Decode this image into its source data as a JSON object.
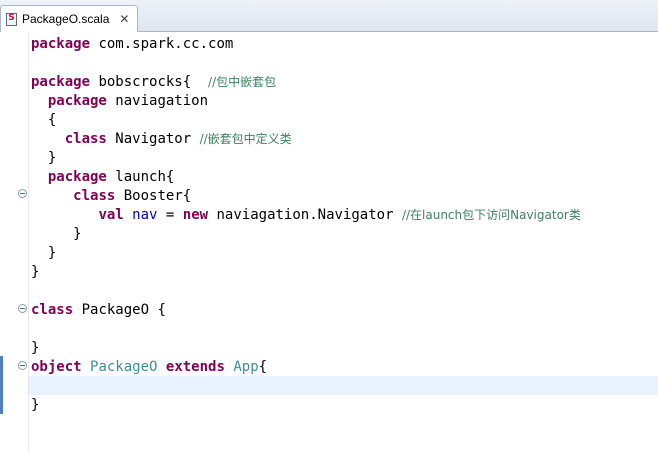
{
  "tab": {
    "title": "PackageO.scala",
    "icon": "scala-file-icon",
    "close": "✕"
  },
  "code": {
    "lines": [
      [
        {
          "t": "package",
          "c": "kw"
        },
        {
          "t": " com.spark.cc.com",
          "c": "tx"
        }
      ],
      [],
      [
        {
          "t": "package",
          "c": "kw"
        },
        {
          "t": " bobscrocks{  ",
          "c": "tx"
        },
        {
          "t": "//包中嵌套包",
          "c": "cm"
        }
      ],
      [
        {
          "t": "  ",
          "c": "tx"
        },
        {
          "t": "package",
          "c": "kw"
        },
        {
          "t": " naviagation",
          "c": "tx"
        }
      ],
      [
        {
          "t": "  {",
          "c": "tx"
        }
      ],
      [
        {
          "t": "    ",
          "c": "tx"
        },
        {
          "t": "class",
          "c": "kw"
        },
        {
          "t": " Navigator ",
          "c": "tx"
        },
        {
          "t": "//嵌套包中定义类",
          "c": "cm"
        }
      ],
      [
        {
          "t": "  }",
          "c": "tx"
        }
      ],
      [
        {
          "t": "  ",
          "c": "tx"
        },
        {
          "t": "package",
          "c": "kw"
        },
        {
          "t": " launch{",
          "c": "tx"
        }
      ],
      [
        {
          "t": "     ",
          "c": "tx"
        },
        {
          "t": "class",
          "c": "kw"
        },
        {
          "t": " Booster{",
          "c": "tx"
        }
      ],
      [
        {
          "t": "        ",
          "c": "tx"
        },
        {
          "t": "val",
          "c": "kw"
        },
        {
          "t": " ",
          "c": "tx"
        },
        {
          "t": "nav",
          "c": "nav"
        },
        {
          "t": " = ",
          "c": "tx"
        },
        {
          "t": "new",
          "c": "kw"
        },
        {
          "t": " naviagation.Navigator ",
          "c": "tx"
        },
        {
          "t": "//在launch包下访问Navigator类",
          "c": "cm"
        }
      ],
      [
        {
          "t": "     }",
          "c": "tx"
        }
      ],
      [
        {
          "t": "  }",
          "c": "tx"
        }
      ],
      [
        {
          "t": "}",
          "c": "tx"
        }
      ],
      [],
      [
        {
          "t": "class",
          "c": "kw"
        },
        {
          "t": " PackageO {",
          "c": "tx"
        }
      ],
      [],
      [
        {
          "t": "}",
          "c": "tx"
        }
      ],
      [
        {
          "t": "object",
          "c": "kw"
        },
        {
          "t": " ",
          "c": "tx"
        },
        {
          "t": "PackageO",
          "c": "ty"
        },
        {
          "t": " ",
          "c": "tx"
        },
        {
          "t": "extends",
          "c": "kw"
        },
        {
          "t": " ",
          "c": "tx"
        },
        {
          "t": "App",
          "c": "ty"
        },
        {
          "t": "{",
          "c": "tx"
        }
      ],
      [],
      [
        {
          "t": "}",
          "c": "tx"
        }
      ]
    ]
  },
  "colors": {
    "keyword": "#7f0055",
    "comment": "#3f7f5f",
    "type": "#3f8f8f",
    "field": "#0000c0",
    "current_line": "#e8f2fe"
  }
}
